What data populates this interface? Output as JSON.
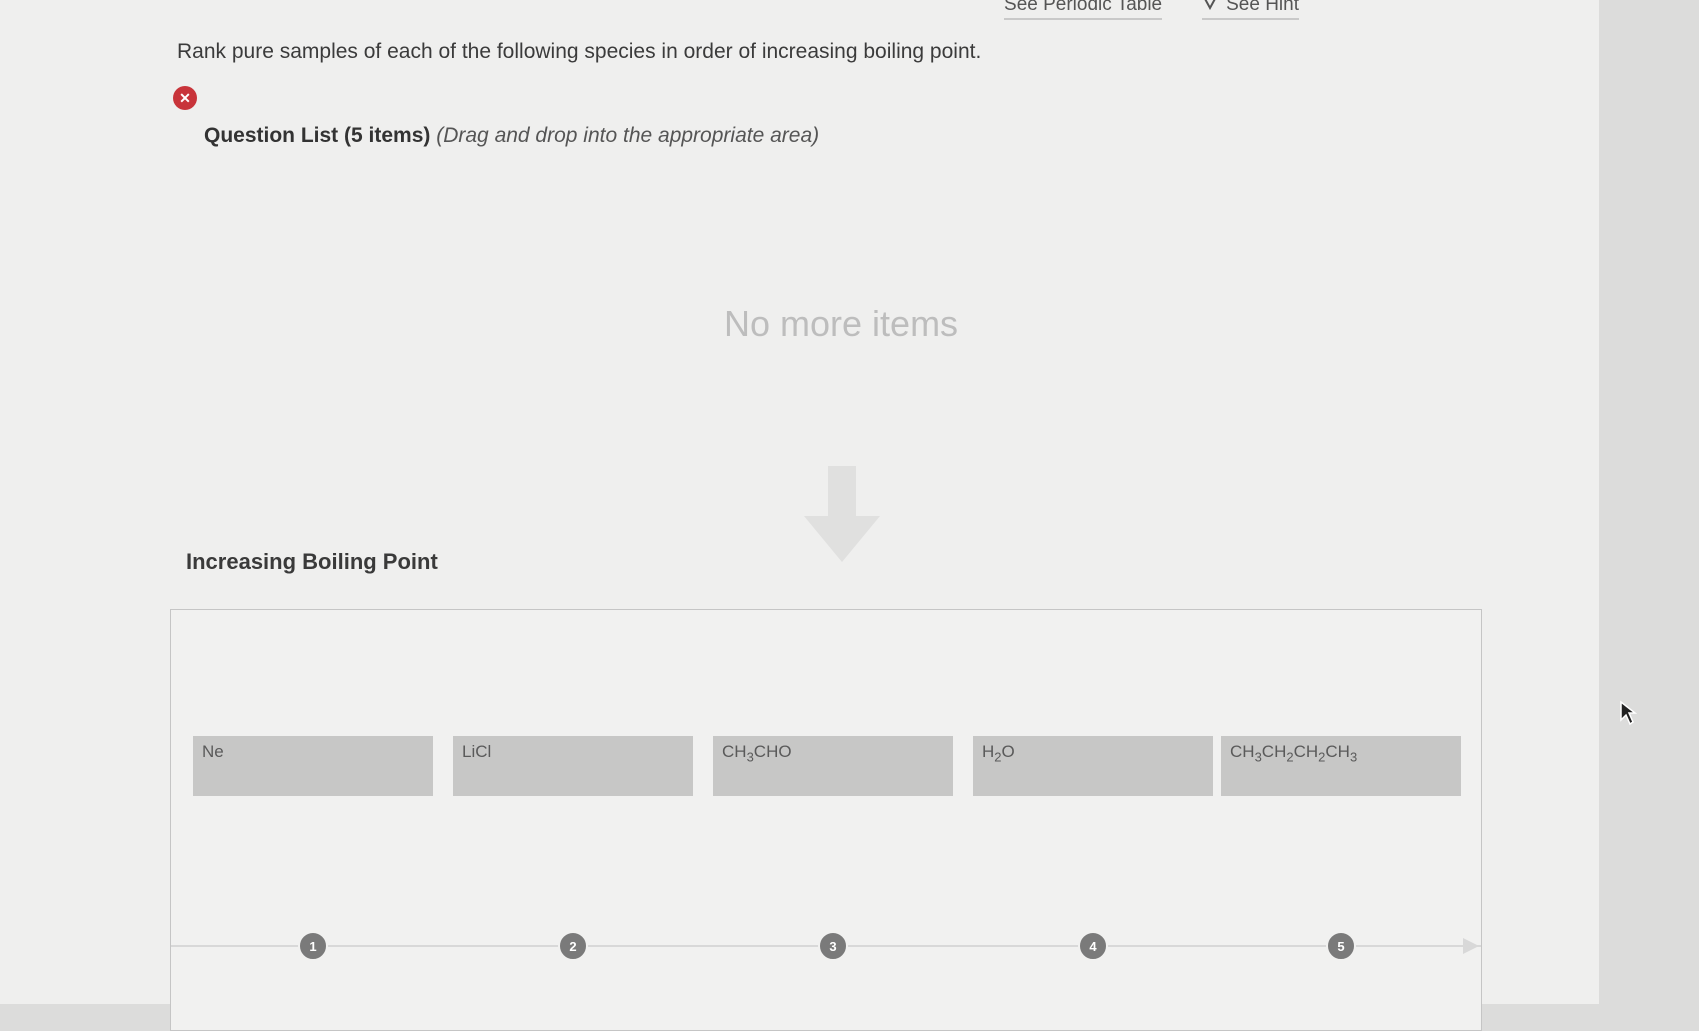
{
  "header": {
    "periodic_table_link": "See Periodic Table",
    "hint_link": "See Hint"
  },
  "question": {
    "prompt": "Rank pure samples of each of the following species in order of increasing boiling point.",
    "status_icon": "error-x-icon"
  },
  "question_list": {
    "title": "Question List (5 items)",
    "instruction": "(Drag and drop into the appropriate area)",
    "empty_message": "No more items"
  },
  "ranking": {
    "title": "Increasing Boiling Point",
    "items": [
      {
        "rank": "1",
        "label": "Ne"
      },
      {
        "rank": "2",
        "label": "LiCl"
      },
      {
        "rank": "3",
        "label": "CH3CHO"
      },
      {
        "rank": "4",
        "label": "H2O"
      },
      {
        "rank": "5",
        "label": "CH3CH2CH2CH3"
      }
    ]
  },
  "colors": {
    "error": "#c8343a",
    "card": "#c7c7c6",
    "marker": "#7a7a7a"
  }
}
